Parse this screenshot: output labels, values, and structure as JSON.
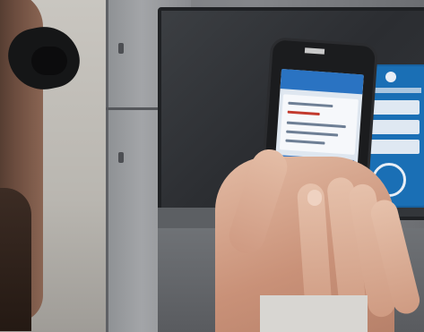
{
  "scene": {
    "alt": ""
  },
  "colors": {
    "phone_body": "#1b1c1e",
    "app_header_blue": "#2a73c2",
    "sign_blue": "#1a6fb5",
    "panel_dark": "#2b2d31",
    "skin": "#d9a48c"
  },
  "icons": {
    "phone_brand_logo": "cat-logo-icon",
    "sign_symbol": "round-badge-icon"
  }
}
